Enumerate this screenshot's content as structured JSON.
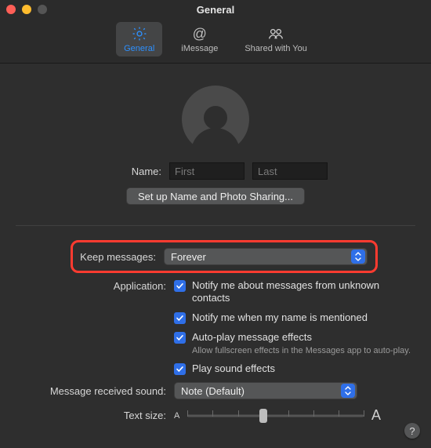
{
  "window": {
    "title": "General"
  },
  "tabs": {
    "general": {
      "label": "General"
    },
    "imessage": {
      "label": "iMessage"
    },
    "shared": {
      "label": "Shared with You"
    }
  },
  "name_section": {
    "label": "Name:",
    "first_placeholder": "First",
    "last_placeholder": "Last",
    "setup_button": "Set up Name and Photo Sharing..."
  },
  "keep_messages": {
    "label": "Keep messages:",
    "value": "Forever"
  },
  "application": {
    "label": "Application:",
    "notify_unknown": "Notify me about messages from unknown contacts",
    "notify_mention": "Notify me when my name is mentioned",
    "autoplay": "Auto-play message effects",
    "autoplay_sub": "Allow fullscreen effects in the Messages app to auto-play.",
    "sound_effects": "Play sound effects"
  },
  "sound": {
    "label": "Message received sound:",
    "value": "Note (Default)"
  },
  "text_size": {
    "label": "Text size:",
    "small_A": "A",
    "big_A": "A"
  },
  "help_glyph": "?"
}
